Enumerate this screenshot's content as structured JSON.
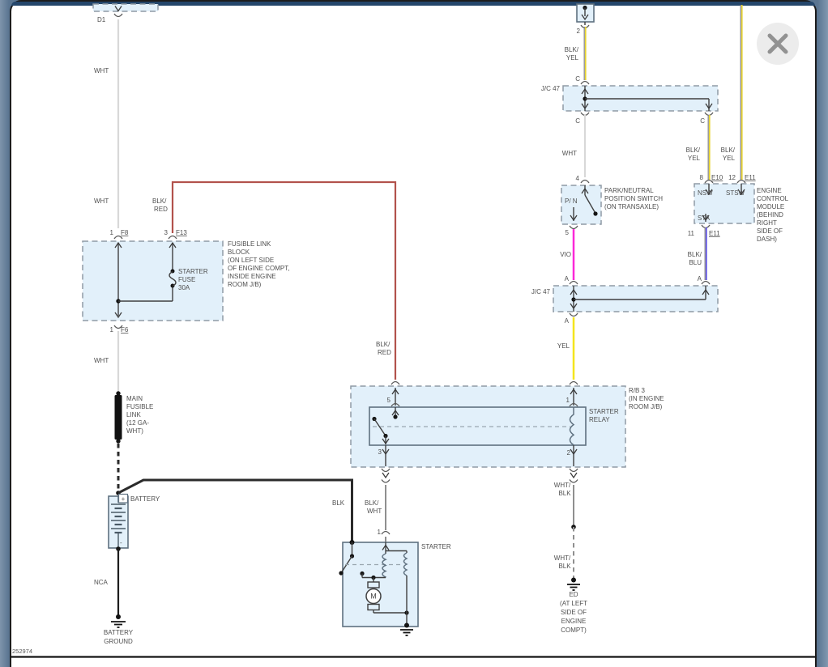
{
  "colors": {
    "wht": "#d8d8d8",
    "blk": "#2b2b2b",
    "blk_red": "#b2524c",
    "yel": "#f4e51d",
    "vio": "#fb28d8",
    "blk_yel": "#e6d32f",
    "blk_blu": "#5a4fe2",
    "wht_blk": "#8f8f8f",
    "box_fill": "#e2f0fa",
    "panel_top": "#24466b",
    "backdrop": "#5f7a96"
  },
  "close_button": {
    "glyph": "✕"
  },
  "footer": {
    "diagram_number": "252974"
  },
  "diagram": {
    "d1_connector": {
      "id": "D1"
    },
    "wire_labels": {
      "wht": "WHT",
      "blk": "BLK",
      "nca": "NCA",
      "yel": "YEL",
      "vio": "VIO",
      "blk_red": [
        "BLK/",
        "RED"
      ],
      "blk_wht": [
        "BLK/",
        "WHT"
      ],
      "wht_blk": [
        "WHT/",
        "BLK"
      ],
      "blk_yel": [
        "BLK/",
        "YEL"
      ],
      "blk_blu": [
        "BLK/",
        "BLU"
      ]
    },
    "fusible_link_block": {
      "pins": {
        "f8_num": "1",
        "f8": "F8",
        "f13_num": "3",
        "f13": "F13",
        "f6_num": "1",
        "f6": "F6"
      },
      "fuse": [
        "STARTER",
        "FUSE",
        "30A"
      ],
      "note": [
        "FUSIBLE LINK",
        "BLOCK",
        "(ON LEFT SIDE",
        "OF ENGINE COMPT,",
        "INSIDE ENGINE",
        "ROOM J/B)"
      ]
    },
    "main_fusible_link": {
      "note": [
        "MAIN",
        "FUSIBLE",
        "LINK",
        "(12 GA-",
        "WHT)"
      ]
    },
    "battery": {
      "label": "BATTERY",
      "plus": "+",
      "minus": "-",
      "ground": [
        "BATTERY",
        "GROUND"
      ]
    },
    "starter_relay": {
      "block": [
        "R/B 3",
        "(IN ENGINE",
        "ROOM J/B)"
      ],
      "name": [
        "STARTER",
        "RELAY"
      ],
      "pins": {
        "p5": "5",
        "p1": "1",
        "p3": "3",
        "p2": "2"
      }
    },
    "starter": {
      "label": "STARTER",
      "pin1": "1",
      "motor": "M"
    },
    "ignition_feed": {
      "pin2": "2",
      "c": "C"
    },
    "jc47": {
      "label": "J/C 47",
      "c": "C",
      "a": "A"
    },
    "pnp_switch": {
      "pin4": "4",
      "pin5": "5",
      "positions": "P/ N",
      "note": [
        "PARK/NEUTRAL",
        "POSITION SWITCH",
        "(ON TRANSAXLE)"
      ]
    },
    "ecm": {
      "pins": {
        "p8": "8",
        "e10": "E10",
        "p12": "12",
        "e11": "E11",
        "p11": "11",
        "e11b": "E11"
      },
      "terminals": {
        "nsw": "NSW",
        "stsw": "STSW",
        "sta": "STA"
      },
      "note": [
        "ENGINE",
        "CONTROL",
        "MODULE",
        "(BEHIND",
        "RIGHT",
        "SIDE OF",
        "DASH)"
      ]
    },
    "ed_ground": {
      "note": [
        "ED",
        "(AT LEFT",
        "SIDE OF",
        "ENGINE",
        "COMPT)"
      ]
    }
  }
}
